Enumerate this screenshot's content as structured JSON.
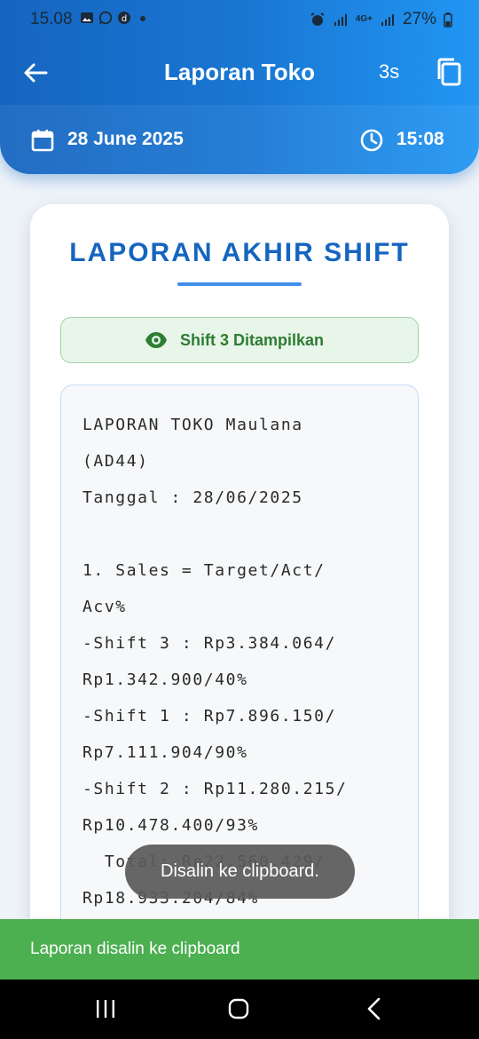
{
  "status_bar": {
    "time": "15.08",
    "battery": "27%",
    "network_label": "4G+"
  },
  "app_bar": {
    "title": "Laporan Toko",
    "timer": "3s"
  },
  "date_bar": {
    "date": "28 June 2025",
    "time": "15:08"
  },
  "card": {
    "title": "LAPORAN AKHIR SHIFT",
    "badge": "Shift 3 Ditampilkan",
    "report_lines": [
      "LAPORAN TOKO Maulana",
      "(AD44)",
      "Tanggal : 28/06/2025",
      "",
      "1. Sales = Target/Act/",
      "Acv%",
      "-Shift 3 : Rp3.384.064/",
      "Rp1.342.900/40%",
      "-Shift 1 : Rp7.896.150/",
      "Rp7.111.904/90%",
      "-Shift 2 : Rp11.280.215/",
      "Rp10.478.400/93%",
      "  Total: Rp22.560.429/",
      "Rp18.933.204/84%"
    ]
  },
  "toast": "Disalin ke clipboard.",
  "snackbar": "Laporan disalin ke clipboard",
  "colors": {
    "primary": "#1976d2",
    "primary_dark": "#1565c0",
    "success": "#4caf50",
    "badge_text": "#2e7d32",
    "badge_bg": "#e8f5e9"
  }
}
